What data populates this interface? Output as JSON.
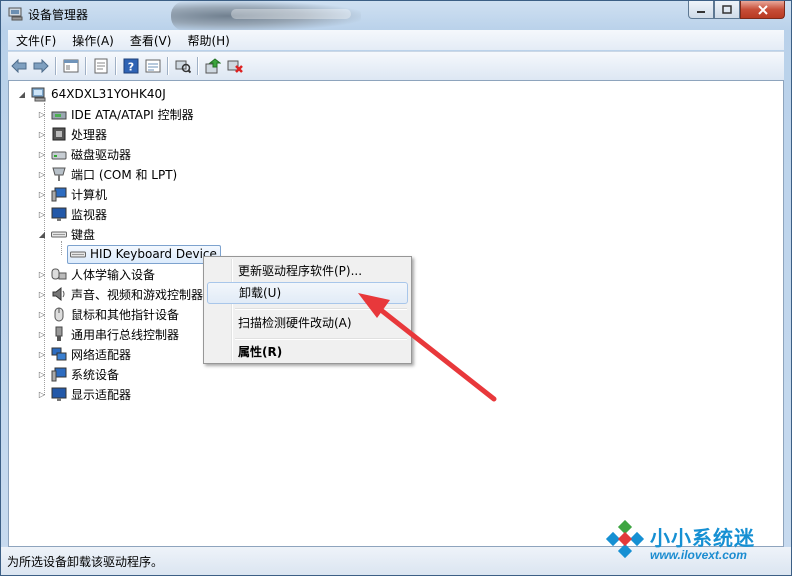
{
  "window": {
    "title": "设备管理器",
    "controls": [
      "minimize-icon",
      "maximize-icon",
      "close-icon"
    ]
  },
  "menu": [
    "文件(F)",
    "操作(A)",
    "查看(V)",
    "帮助(H)"
  ],
  "toolbar": [
    "back-icon",
    "forward-icon",
    "show-hide-console-tree-icon",
    "properties-icon",
    "help-icon",
    "view-icon",
    "scan-hardware-icon",
    "update-driver-icon",
    "uninstall-icon"
  ],
  "tree": {
    "root": "64XDXL31YOHK40J",
    "items": [
      {
        "label": "IDE ATA/ATAPI 控制器",
        "icon": "ide-controller-icon",
        "expanded": false
      },
      {
        "label": "处理器",
        "icon": "processor-icon",
        "expanded": false
      },
      {
        "label": "磁盘驱动器",
        "icon": "disk-drive-icon",
        "expanded": false
      },
      {
        "label": "端口 (COM 和 LPT)",
        "icon": "port-icon",
        "expanded": false
      },
      {
        "label": "计算机",
        "icon": "computer-icon",
        "expanded": false
      },
      {
        "label": "监视器",
        "icon": "monitor-icon",
        "expanded": false
      },
      {
        "label": "键盘",
        "icon": "keyboard-icon",
        "expanded": true
      },
      {
        "label": "HID Keyboard Device",
        "icon": "keyboard-icon",
        "child": true,
        "selected": true
      },
      {
        "label": "人体学输入设备",
        "icon": "hid-icon",
        "expanded": false
      },
      {
        "label": "声音、视频和游戏控制器",
        "icon": "speaker-icon",
        "expanded": false
      },
      {
        "label": "鼠标和其他指针设备",
        "icon": "mouse-icon",
        "expanded": false
      },
      {
        "label": "通用串行总线控制器",
        "icon": "usb-icon",
        "expanded": false
      },
      {
        "label": "网络适配器",
        "icon": "network-icon",
        "expanded": false
      },
      {
        "label": "系统设备",
        "icon": "system-device-icon",
        "expanded": false
      },
      {
        "label": "显示适配器",
        "icon": "display-adapter-icon",
        "expanded": false
      }
    ]
  },
  "context_menu": {
    "items": [
      {
        "label": "更新驱动程序软件(P)..."
      },
      {
        "label": "卸载(U)",
        "highlighted": true
      },
      {
        "label": "扫描检测硬件改动(A)"
      },
      {
        "label": "属性(R)",
        "bold": true
      }
    ]
  },
  "status": "为所选设备卸载该驱动程序。",
  "watermark": {
    "title": "小小系统迷",
    "url": "www.ilovext.com"
  },
  "colors": {
    "annotation_arrow": "#e8383b",
    "watermark": "#1690d3"
  }
}
